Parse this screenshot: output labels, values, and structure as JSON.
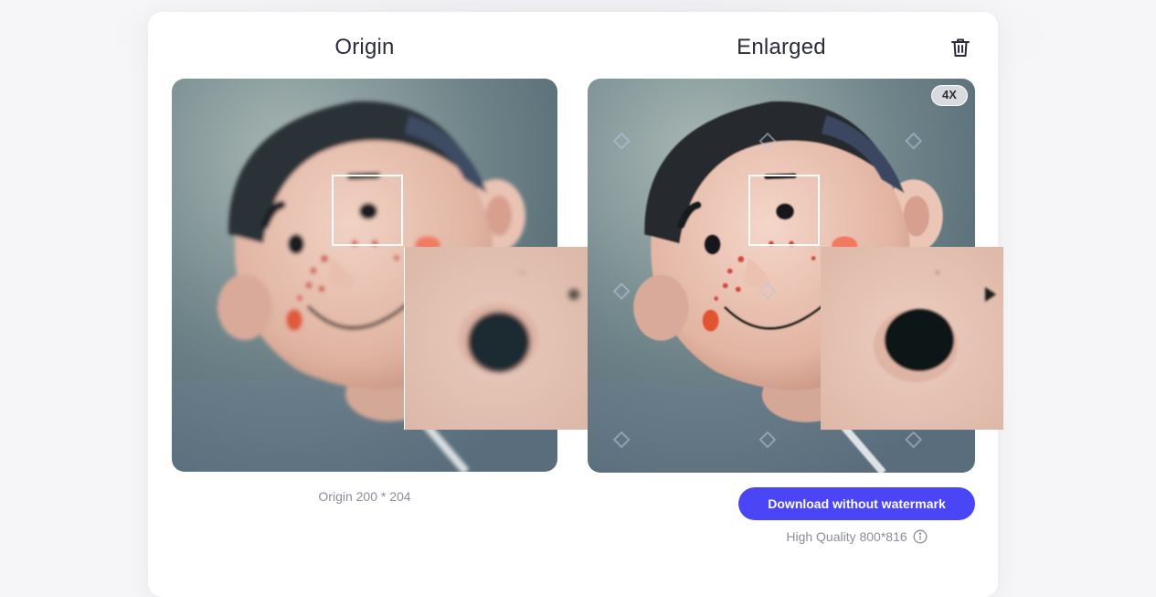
{
  "columns": {
    "origin_title": "Origin",
    "enlarged_title": "Enlarged"
  },
  "icons": {
    "delete": "trash-icon",
    "info": "info-icon"
  },
  "enlarged": {
    "scale_badge": "4X",
    "quality_label": "High Quality 800*816"
  },
  "origin": {
    "size_label": "Origin 200 * 204"
  },
  "actions": {
    "download_label": "Download without watermark"
  },
  "colors": {
    "accent": "#4b46f5",
    "title_text": "#2b2d3a",
    "muted_text": "#8b8e99"
  }
}
